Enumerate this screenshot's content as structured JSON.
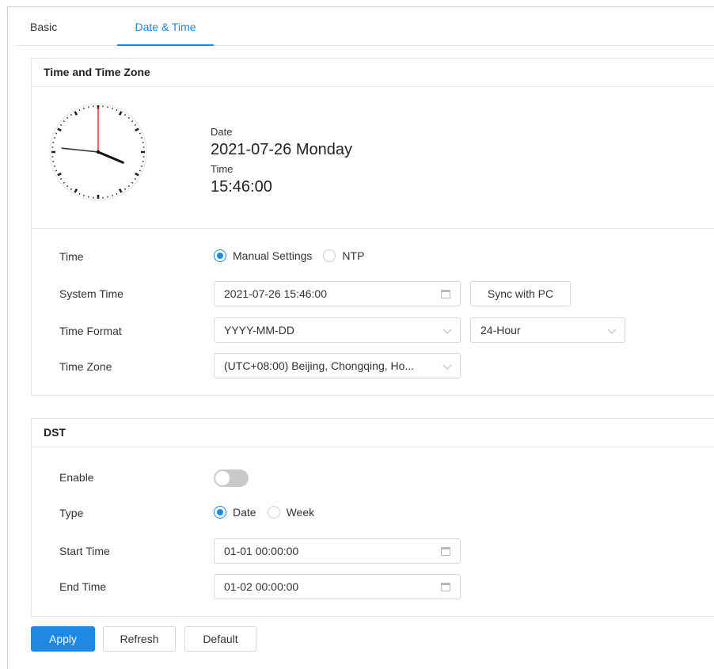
{
  "tabs": [
    {
      "label": "Basic",
      "active": false
    },
    {
      "label": "Date & Time",
      "active": true
    }
  ],
  "time_zone_section": {
    "title": "Time and Time Zone",
    "date_label": "Date",
    "date_value": "2021-07-26 Monday",
    "time_label": "Time",
    "time_value": "15:46:00",
    "clock": {
      "hour": 15,
      "minute": 46,
      "second": 0
    },
    "rows": {
      "time": {
        "label": "Time",
        "options": [
          "Manual Settings",
          "NTP"
        ],
        "selected": "Manual Settings"
      },
      "system_time": {
        "label": "System Time",
        "value": "2021-07-26 15:46:00",
        "icon": "calendar-icon",
        "sync_button": "Sync with PC"
      },
      "time_format": {
        "label": "Time Format",
        "date_format": "YYYY-MM-DD",
        "hour_format": "24-Hour"
      },
      "time_zone": {
        "label": "Time Zone",
        "value": "(UTC+08:00) Beijing, Chongqing, Ho..."
      }
    }
  },
  "dst_section": {
    "title": "DST",
    "enable": {
      "label": "Enable",
      "on": false
    },
    "type": {
      "label": "Type",
      "options": [
        "Date",
        "Week"
      ],
      "selected": "Date"
    },
    "start_time": {
      "label": "Start Time",
      "value": "01-01 00:00:00",
      "icon": "calendar-icon"
    },
    "end_time": {
      "label": "End Time",
      "value": "01-02 00:00:00",
      "icon": "calendar-icon"
    }
  },
  "actions": {
    "apply": "Apply",
    "refresh": "Refresh",
    "default": "Default"
  },
  "colors": {
    "accent": "#1e88e5",
    "second_hand": "#d32f2f",
    "toggle_off": "#c9c9c9"
  }
}
